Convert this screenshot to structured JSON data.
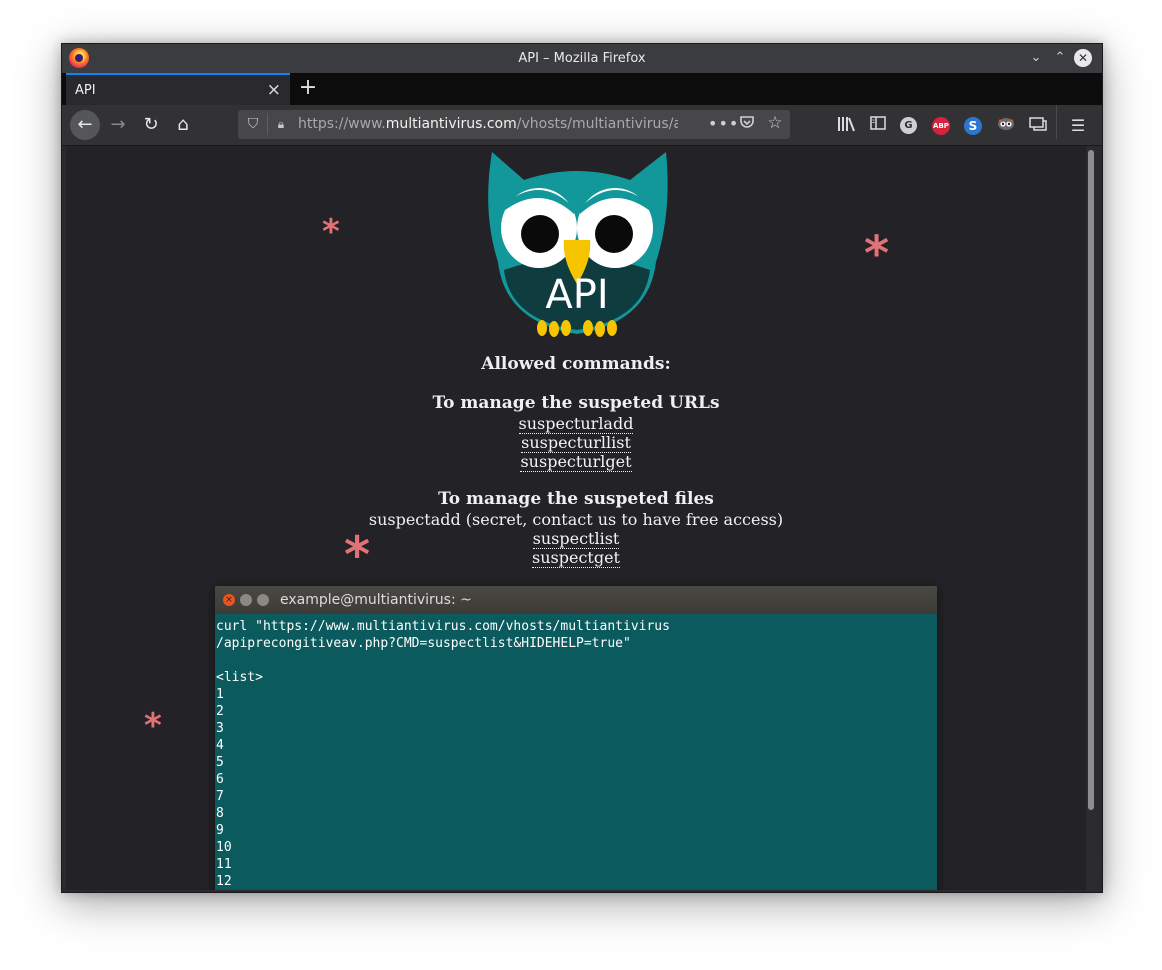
{
  "window": {
    "title": "API – Mozilla Firefox",
    "controls": {
      "minimize": "⌄",
      "maximize": "⌃",
      "close": "✕"
    }
  },
  "tabs": [
    {
      "label": "API",
      "active": true
    }
  ],
  "toolbar": {
    "url_prefix": "https://www.",
    "url_domain": "multiantivirus.com",
    "url_path": "/vhosts/multiantivirus/apiprecongitiveav.php",
    "icons": [
      "back-icon",
      "forward-icon",
      "reload-icon",
      "home-icon",
      "shield-icon",
      "lock-icon",
      "more-icon",
      "pocket-icon",
      "star-icon",
      "library-icon",
      "sidebar-icon",
      "g-extension-icon",
      "abp-icon",
      "s-extension-icon",
      "tracker-icon",
      "synced-tabs-icon",
      "menu-icon"
    ],
    "g_label": "G",
    "abp_label": "ABP",
    "s_label": "S"
  },
  "page": {
    "logo_text": "API",
    "heading": "Allowed commands:",
    "url_section_title": "To manage the suspeted URLs",
    "url_commands": [
      "suspecturladd",
      "suspecturllist",
      "suspecturlget"
    ],
    "file_section_title": "To manage the suspeted files",
    "file_note": "suspectadd (secret, contact us to have free access)",
    "file_commands": [
      "suspectlist",
      "suspectget"
    ]
  },
  "terminal": {
    "title": "example@multiantivirus: ~",
    "lines": [
      "curl \"https://www.multiantivirus.com/vhosts/multiantivirus",
      "/apiprecongitiveav.php?CMD=suspectlist&HIDEHELP=true\"",
      "",
      "<list>",
      "1",
      "2",
      "3",
      "4",
      "5",
      "6",
      "7",
      "8",
      "9",
      "10",
      "11",
      "12"
    ]
  },
  "colors": {
    "accent_tab": "#0a84ff",
    "page_bg": "#232327",
    "terminal_bg": "#0a5a5e",
    "asterisk": "#e07278"
  }
}
